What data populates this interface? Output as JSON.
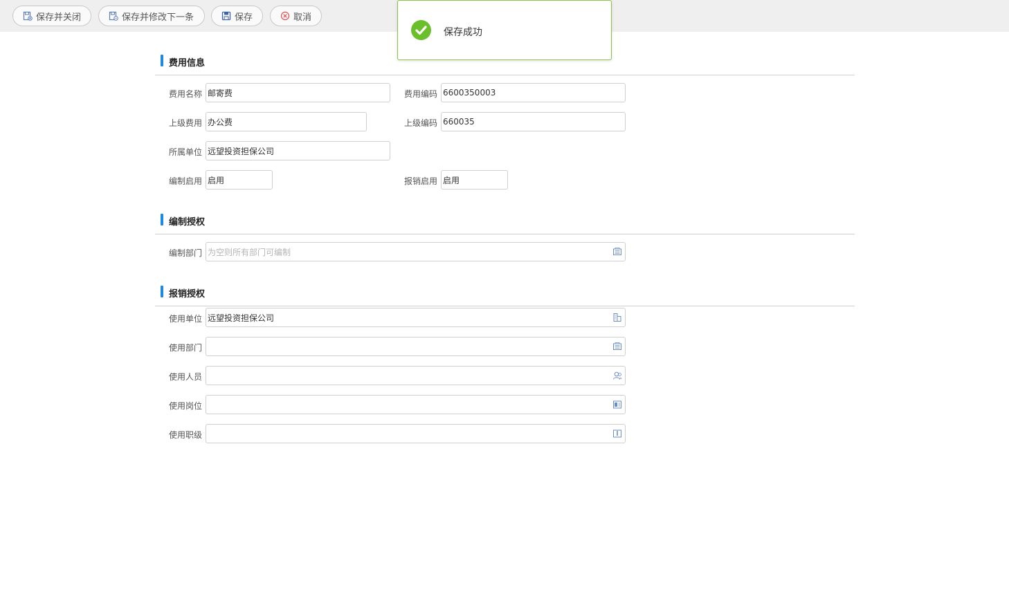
{
  "toolbar": {
    "save_close": "保存并关闭",
    "save_edit_next": "保存并修改下一条",
    "save": "保存",
    "cancel": "取消"
  },
  "toast": {
    "message": "保存成功"
  },
  "sections": {
    "fee_info": "费用信息",
    "edit_auth": "编制授权",
    "reimburse_auth": "报销授权"
  },
  "fee_info": {
    "name_label": "费用名称",
    "name_value": "邮寄费",
    "code_label": "费用编码",
    "code_value": "6600350003",
    "parent_label": "上级费用",
    "parent_value": "办公费",
    "parent_code_label": "上级编码",
    "parent_code_value": "660035",
    "unit_label": "所属单位",
    "unit_value": "远望投资担保公司",
    "edit_enable_label": "编制启用",
    "edit_enable_value": "启用",
    "reimb_enable_label": "报销启用",
    "reimb_enable_value": "启用"
  },
  "edit_auth": {
    "dept_label": "编制部门",
    "dept_placeholder": "为空则所有部门可编制"
  },
  "reimburse_auth": {
    "unit_label": "使用单位",
    "unit_value": "远望投资担保公司",
    "dept_label": "使用部门",
    "dept_value": "",
    "person_label": "使用人员",
    "person_value": "",
    "post_label": "使用岗位",
    "post_value": "",
    "rank_label": "使用职级",
    "rank_value": ""
  },
  "colors": {
    "accent": "#1e88e5",
    "success": "#6abf2a",
    "toast_border": "#8bc34a"
  },
  "icons": [
    "save-close-icon",
    "save-next-icon",
    "save-icon",
    "cancel-icon",
    "success-check-icon",
    "department-picker-icon",
    "unit-picker-icon",
    "person-picker-icon",
    "post-picker-icon",
    "rank-picker-icon"
  ]
}
